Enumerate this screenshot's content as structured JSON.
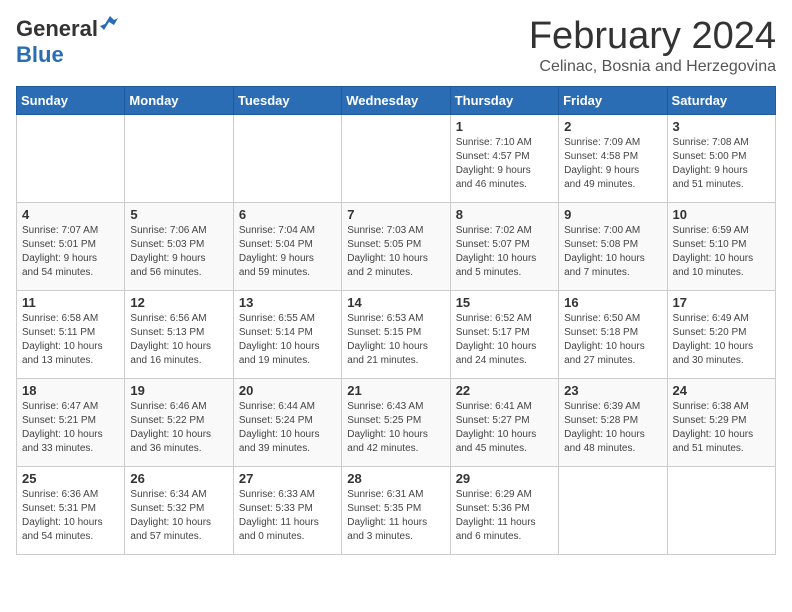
{
  "header": {
    "logo": {
      "general": "General",
      "blue": "Blue"
    },
    "title": "February 2024",
    "location": "Celinac, Bosnia and Herzegovina"
  },
  "calendar": {
    "days_of_week": [
      "Sunday",
      "Monday",
      "Tuesday",
      "Wednesday",
      "Thursday",
      "Friday",
      "Saturday"
    ],
    "weeks": [
      [
        {
          "day": "",
          "content": ""
        },
        {
          "day": "",
          "content": ""
        },
        {
          "day": "",
          "content": ""
        },
        {
          "day": "",
          "content": ""
        },
        {
          "day": "1",
          "content": "Sunrise: 7:10 AM\nSunset: 4:57 PM\nDaylight: 9 hours\nand 46 minutes."
        },
        {
          "day": "2",
          "content": "Sunrise: 7:09 AM\nSunset: 4:58 PM\nDaylight: 9 hours\nand 49 minutes."
        },
        {
          "day": "3",
          "content": "Sunrise: 7:08 AM\nSunset: 5:00 PM\nDaylight: 9 hours\nand 51 minutes."
        }
      ],
      [
        {
          "day": "4",
          "content": "Sunrise: 7:07 AM\nSunset: 5:01 PM\nDaylight: 9 hours\nand 54 minutes."
        },
        {
          "day": "5",
          "content": "Sunrise: 7:06 AM\nSunset: 5:03 PM\nDaylight: 9 hours\nand 56 minutes."
        },
        {
          "day": "6",
          "content": "Sunrise: 7:04 AM\nSunset: 5:04 PM\nDaylight: 9 hours\nand 59 minutes."
        },
        {
          "day": "7",
          "content": "Sunrise: 7:03 AM\nSunset: 5:05 PM\nDaylight: 10 hours\nand 2 minutes."
        },
        {
          "day": "8",
          "content": "Sunrise: 7:02 AM\nSunset: 5:07 PM\nDaylight: 10 hours\nand 5 minutes."
        },
        {
          "day": "9",
          "content": "Sunrise: 7:00 AM\nSunset: 5:08 PM\nDaylight: 10 hours\nand 7 minutes."
        },
        {
          "day": "10",
          "content": "Sunrise: 6:59 AM\nSunset: 5:10 PM\nDaylight: 10 hours\nand 10 minutes."
        }
      ],
      [
        {
          "day": "11",
          "content": "Sunrise: 6:58 AM\nSunset: 5:11 PM\nDaylight: 10 hours\nand 13 minutes."
        },
        {
          "day": "12",
          "content": "Sunrise: 6:56 AM\nSunset: 5:13 PM\nDaylight: 10 hours\nand 16 minutes."
        },
        {
          "day": "13",
          "content": "Sunrise: 6:55 AM\nSunset: 5:14 PM\nDaylight: 10 hours\nand 19 minutes."
        },
        {
          "day": "14",
          "content": "Sunrise: 6:53 AM\nSunset: 5:15 PM\nDaylight: 10 hours\nand 21 minutes."
        },
        {
          "day": "15",
          "content": "Sunrise: 6:52 AM\nSunset: 5:17 PM\nDaylight: 10 hours\nand 24 minutes."
        },
        {
          "day": "16",
          "content": "Sunrise: 6:50 AM\nSunset: 5:18 PM\nDaylight: 10 hours\nand 27 minutes."
        },
        {
          "day": "17",
          "content": "Sunrise: 6:49 AM\nSunset: 5:20 PM\nDaylight: 10 hours\nand 30 minutes."
        }
      ],
      [
        {
          "day": "18",
          "content": "Sunrise: 6:47 AM\nSunset: 5:21 PM\nDaylight: 10 hours\nand 33 minutes."
        },
        {
          "day": "19",
          "content": "Sunrise: 6:46 AM\nSunset: 5:22 PM\nDaylight: 10 hours\nand 36 minutes."
        },
        {
          "day": "20",
          "content": "Sunrise: 6:44 AM\nSunset: 5:24 PM\nDaylight: 10 hours\nand 39 minutes."
        },
        {
          "day": "21",
          "content": "Sunrise: 6:43 AM\nSunset: 5:25 PM\nDaylight: 10 hours\nand 42 minutes."
        },
        {
          "day": "22",
          "content": "Sunrise: 6:41 AM\nSunset: 5:27 PM\nDaylight: 10 hours\nand 45 minutes."
        },
        {
          "day": "23",
          "content": "Sunrise: 6:39 AM\nSunset: 5:28 PM\nDaylight: 10 hours\nand 48 minutes."
        },
        {
          "day": "24",
          "content": "Sunrise: 6:38 AM\nSunset: 5:29 PM\nDaylight: 10 hours\nand 51 minutes."
        }
      ],
      [
        {
          "day": "25",
          "content": "Sunrise: 6:36 AM\nSunset: 5:31 PM\nDaylight: 10 hours\nand 54 minutes."
        },
        {
          "day": "26",
          "content": "Sunrise: 6:34 AM\nSunset: 5:32 PM\nDaylight: 10 hours\nand 57 minutes."
        },
        {
          "day": "27",
          "content": "Sunrise: 6:33 AM\nSunset: 5:33 PM\nDaylight: 11 hours\nand 0 minutes."
        },
        {
          "day": "28",
          "content": "Sunrise: 6:31 AM\nSunset: 5:35 PM\nDaylight: 11 hours\nand 3 minutes."
        },
        {
          "day": "29",
          "content": "Sunrise: 6:29 AM\nSunset: 5:36 PM\nDaylight: 11 hours\nand 6 minutes."
        },
        {
          "day": "",
          "content": ""
        },
        {
          "day": "",
          "content": ""
        }
      ]
    ]
  }
}
